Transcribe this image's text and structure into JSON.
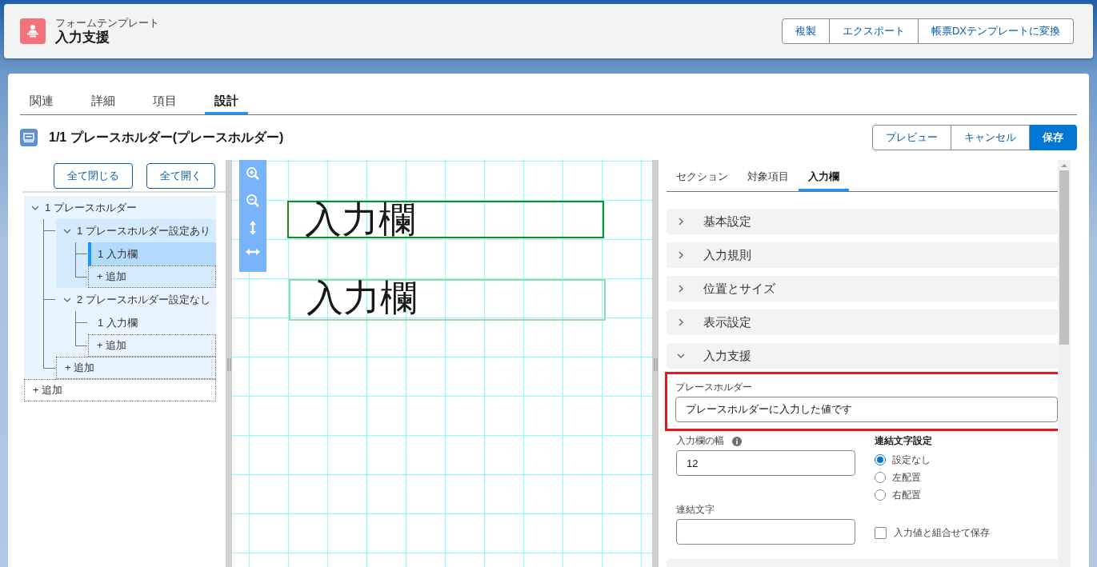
{
  "header": {
    "object_type": "フォームテンプレート",
    "title": "入力支援",
    "actions": [
      "複製",
      "エクスポート",
      "帳票DXテンプレートに変換"
    ]
  },
  "tabs": [
    {
      "label": "関連",
      "selected": false
    },
    {
      "label": "詳細",
      "selected": false
    },
    {
      "label": "項目",
      "selected": false
    },
    {
      "label": "設計",
      "selected": true
    }
  ],
  "design": {
    "title": "1/1 プレースホルダー(プレースホルダー)",
    "actions": [
      {
        "label": "プレビュー",
        "kind": "neutral"
      },
      {
        "label": "キャンセル",
        "kind": "neutral"
      },
      {
        "label": "保存",
        "kind": "brand"
      }
    ]
  },
  "tree": {
    "buttons": [
      "全て閉じる",
      "全て開く"
    ],
    "items": [
      {
        "kind": "group",
        "label": "1 プレースホルダー",
        "expanded": true,
        "selected": true,
        "children": [
          {
            "kind": "group",
            "label": "1 プレースホルダー設定あり",
            "expanded": true,
            "selected": true,
            "children": [
              {
                "kind": "field",
                "label": "1 入力欄",
                "selected": true
              },
              {
                "kind": "add",
                "label": "+ 追加"
              }
            ]
          },
          {
            "kind": "group",
            "label": "2 プレースホルダー設定なし",
            "expanded": true,
            "selected": false,
            "children": [
              {
                "kind": "field",
                "label": "1 入力欄",
                "selected": false
              },
              {
                "kind": "add",
                "label": "+ 追加"
              }
            ]
          },
          {
            "kind": "add",
            "label": "+ 追加"
          }
        ]
      },
      {
        "kind": "add",
        "label": "+ 追加"
      }
    ]
  },
  "canvas": {
    "fields": [
      {
        "label": "入力欄",
        "selected": true
      },
      {
        "label": "入力欄",
        "selected": false
      }
    ]
  },
  "properties": {
    "tabs": [
      {
        "label": "セクション",
        "selected": false
      },
      {
        "label": "対象項目",
        "selected": false
      },
      {
        "label": "入力欄",
        "selected": true
      }
    ],
    "sections": [
      {
        "label": "基本設定",
        "expanded": false
      },
      {
        "label": "入力規則",
        "expanded": false
      },
      {
        "label": "位置とサイズ",
        "expanded": false
      },
      {
        "label": "表示設定",
        "expanded": false
      },
      {
        "label": "入力支援",
        "expanded": true
      }
    ],
    "placeholder_field": {
      "label": "プレースホルダー",
      "value": "プレースホルダーに入力した値です",
      "highlighted": true
    },
    "width_field": {
      "label": "入力欄の幅",
      "value": "12"
    },
    "joiner_setting": {
      "label": "連結文字設定",
      "options": [
        {
          "label": "設定なし",
          "selected": true
        },
        {
          "label": "左配置",
          "selected": false
        },
        {
          "label": "右配置",
          "selected": false
        }
      ]
    },
    "joiner_field": {
      "label": "連結文字"
    },
    "save_combined": {
      "label": "入力値と組合せて保存",
      "checked": false
    }
  }
}
